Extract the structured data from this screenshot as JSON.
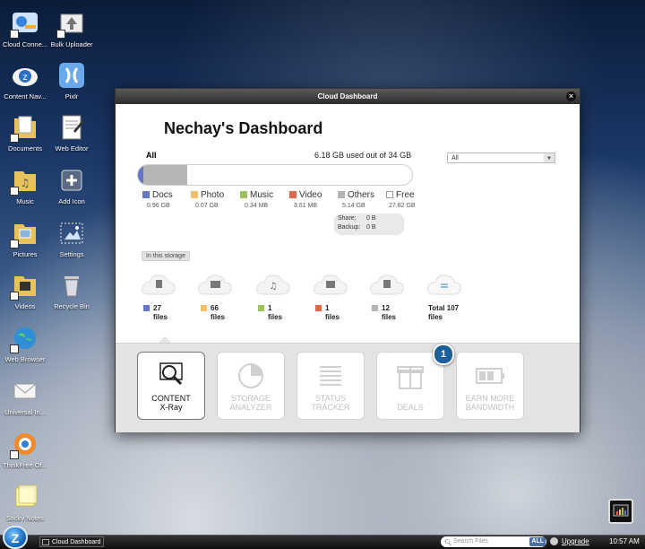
{
  "desktop": {
    "icons": [
      {
        "label": "Cloud Conne..."
      },
      {
        "label": "Bulk Uploader"
      },
      {
        "label": "Content Nav..."
      },
      {
        "label": "Pixlr"
      },
      {
        "label": "Documents"
      },
      {
        "label": "Web Editor"
      },
      {
        "label": "Music"
      },
      {
        "label": "Add Icon"
      },
      {
        "label": "Pictures"
      },
      {
        "label": "Settings"
      },
      {
        "label": "Videos"
      },
      {
        "label": "Recycle Bin"
      },
      {
        "label": "Web Browser"
      },
      {
        "label": "Universal In..."
      },
      {
        "label": "ThinkFree Of..."
      },
      {
        "label": "Sticky Notes"
      }
    ]
  },
  "window": {
    "title": "Cloud Dashboard",
    "close": "×",
    "dashboard_title": "Nechay's Dashboard",
    "storage_label": "All",
    "used_text": "6.18 GB used out of 34 GB",
    "used_fraction": 0.18,
    "filter_select": "All",
    "select_arrow": "▼",
    "legend": [
      {
        "name": "Docs",
        "size": "0.96 GB",
        "color": "#6477c4"
      },
      {
        "name": "Photo",
        "size": "0.07 GB",
        "color": "#f2c26b"
      },
      {
        "name": "Music",
        "size": "0.34 MB",
        "color": "#9ec25a"
      },
      {
        "name": "Video",
        "size": "3.61 MB",
        "color": "#e2674a"
      },
      {
        "name": "Others",
        "size": "5.14 GB",
        "color": "#b5b5b5"
      },
      {
        "name": "Free",
        "size": "27.82 GB",
        "color": "#ffffff"
      }
    ],
    "share_label": "Share:",
    "share_value": "0 B",
    "backup_label": "Backup:",
    "backup_value": "0 B",
    "in_storage_chip": "In this storage",
    "file_counts": [
      {
        "count": "27",
        "unit": "files",
        "color": "#6477c4"
      },
      {
        "count": "66",
        "unit": "files",
        "color": "#f2c26b"
      },
      {
        "count": "1",
        "unit": "files",
        "color": "#9ec25a"
      },
      {
        "count": "1",
        "unit": "files",
        "color": "#e2674a"
      },
      {
        "count": "12",
        "unit": "files",
        "color": "#b5b5b5"
      },
      {
        "count": "Total 107",
        "unit": "files",
        "color": ""
      }
    ],
    "tiles": [
      {
        "line1": "CONTENT",
        "line2": "X-Ray"
      },
      {
        "line1": "STORAGE",
        "line2": "ANALYZER"
      },
      {
        "line1": "STATUS",
        "line2": "TRACKER"
      },
      {
        "line1": "DEALS",
        "line2": ""
      },
      {
        "line1": "EARN MORE",
        "line2": "BANDWIDTH"
      }
    ],
    "deals_badge": "1"
  },
  "taskbar": {
    "start_glyph": "Z",
    "task_item": "Cloud Dashboard",
    "search_placeholder": "Search Files",
    "search_scope": "ALL",
    "upgrade": "Upgrade",
    "clock": "10:57 AM"
  }
}
